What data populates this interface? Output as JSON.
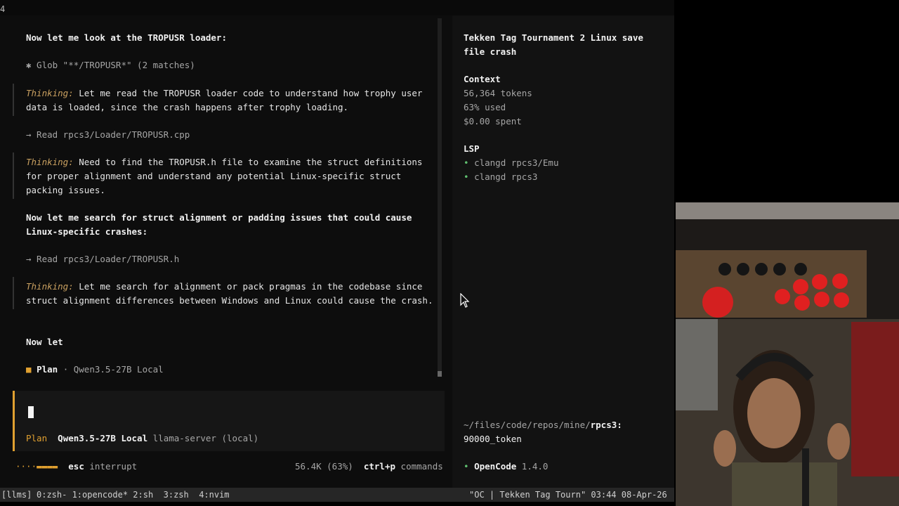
{
  "pane_id": "4",
  "chat": {
    "l1": "Now let me look at the TROPUSR loader:",
    "l2": "✱ Glob \"**/TROPUSR*\" (2 matches)",
    "t1_label": "Thinking:",
    "t1_a": " Let me read the TROPUSR loader code to understand how trophy user",
    "t1_b": "data is loaded, since the crash happens after trophy loading.",
    "l3": "→ Read rpcs3/Loader/TROPUSR.cpp",
    "t2_label": "Thinking:",
    "t2_a": " Need to find the TROPUSR.h file to examine the struct definitions",
    "t2_b": "for proper alignment and understand any potential Linux-specific struct",
    "t2_c": "packing issues.",
    "l4a": "Now let me search for struct alignment or padding issues that could cause",
    "l4b": "Linux-specific crashes:",
    "l5": "→ Read rpcs3/Loader/TROPUSR.h",
    "t3_label": "Thinking:",
    "t3_a": " Let me search for alignment or pack pragmas in the codebase since",
    "t3_b": "struct alignment differences between Windows and Linux could cause the crash.",
    "l6": "Now let",
    "plan_marker": "■",
    "plan_label": "Plan",
    "plan_sep": " · ",
    "plan_model": "Qwen3.5-27B Local"
  },
  "input": {
    "mode": "Plan",
    "model": "Qwen3.5-27B Local",
    "provider": "llama-server (local)"
  },
  "footer": {
    "spinner": "····▬▬▬▬",
    "esc_key": "esc",
    "esc_label": " interrupt",
    "usage": "56.4K (63%)",
    "cmd_key": "ctrl+p",
    "cmd_label": " commands"
  },
  "sidebar": {
    "title_a": "Tekken Tag Tournament 2 Linux save",
    "title_b": "file crash",
    "context_header": "Context",
    "tokens": "56,364 tokens",
    "used": "63% used",
    "spent": "$0.00 spent",
    "lsp_header": "LSP",
    "lsp1": "clangd rpcs3/Emu",
    "lsp2": "clangd rpcs3",
    "bullet": "•",
    "path_prefix": "~/files/code/repos/mine/",
    "path_repo": "rpcs3:",
    "branch": "90000_token",
    "app_name": "OpenCode",
    "app_version": " 1.4.0"
  },
  "tmux": {
    "session": "[llms]",
    "windows": "0:zsh- 1:opencode* 2:sh  3:zsh  4:nvim",
    "right": "\"OC | Tekken Tag Tourn\" 03:44 08-Apr-26"
  },
  "colors": {
    "accent": "#e0a030",
    "lsp_green": "#5fbf6f"
  }
}
